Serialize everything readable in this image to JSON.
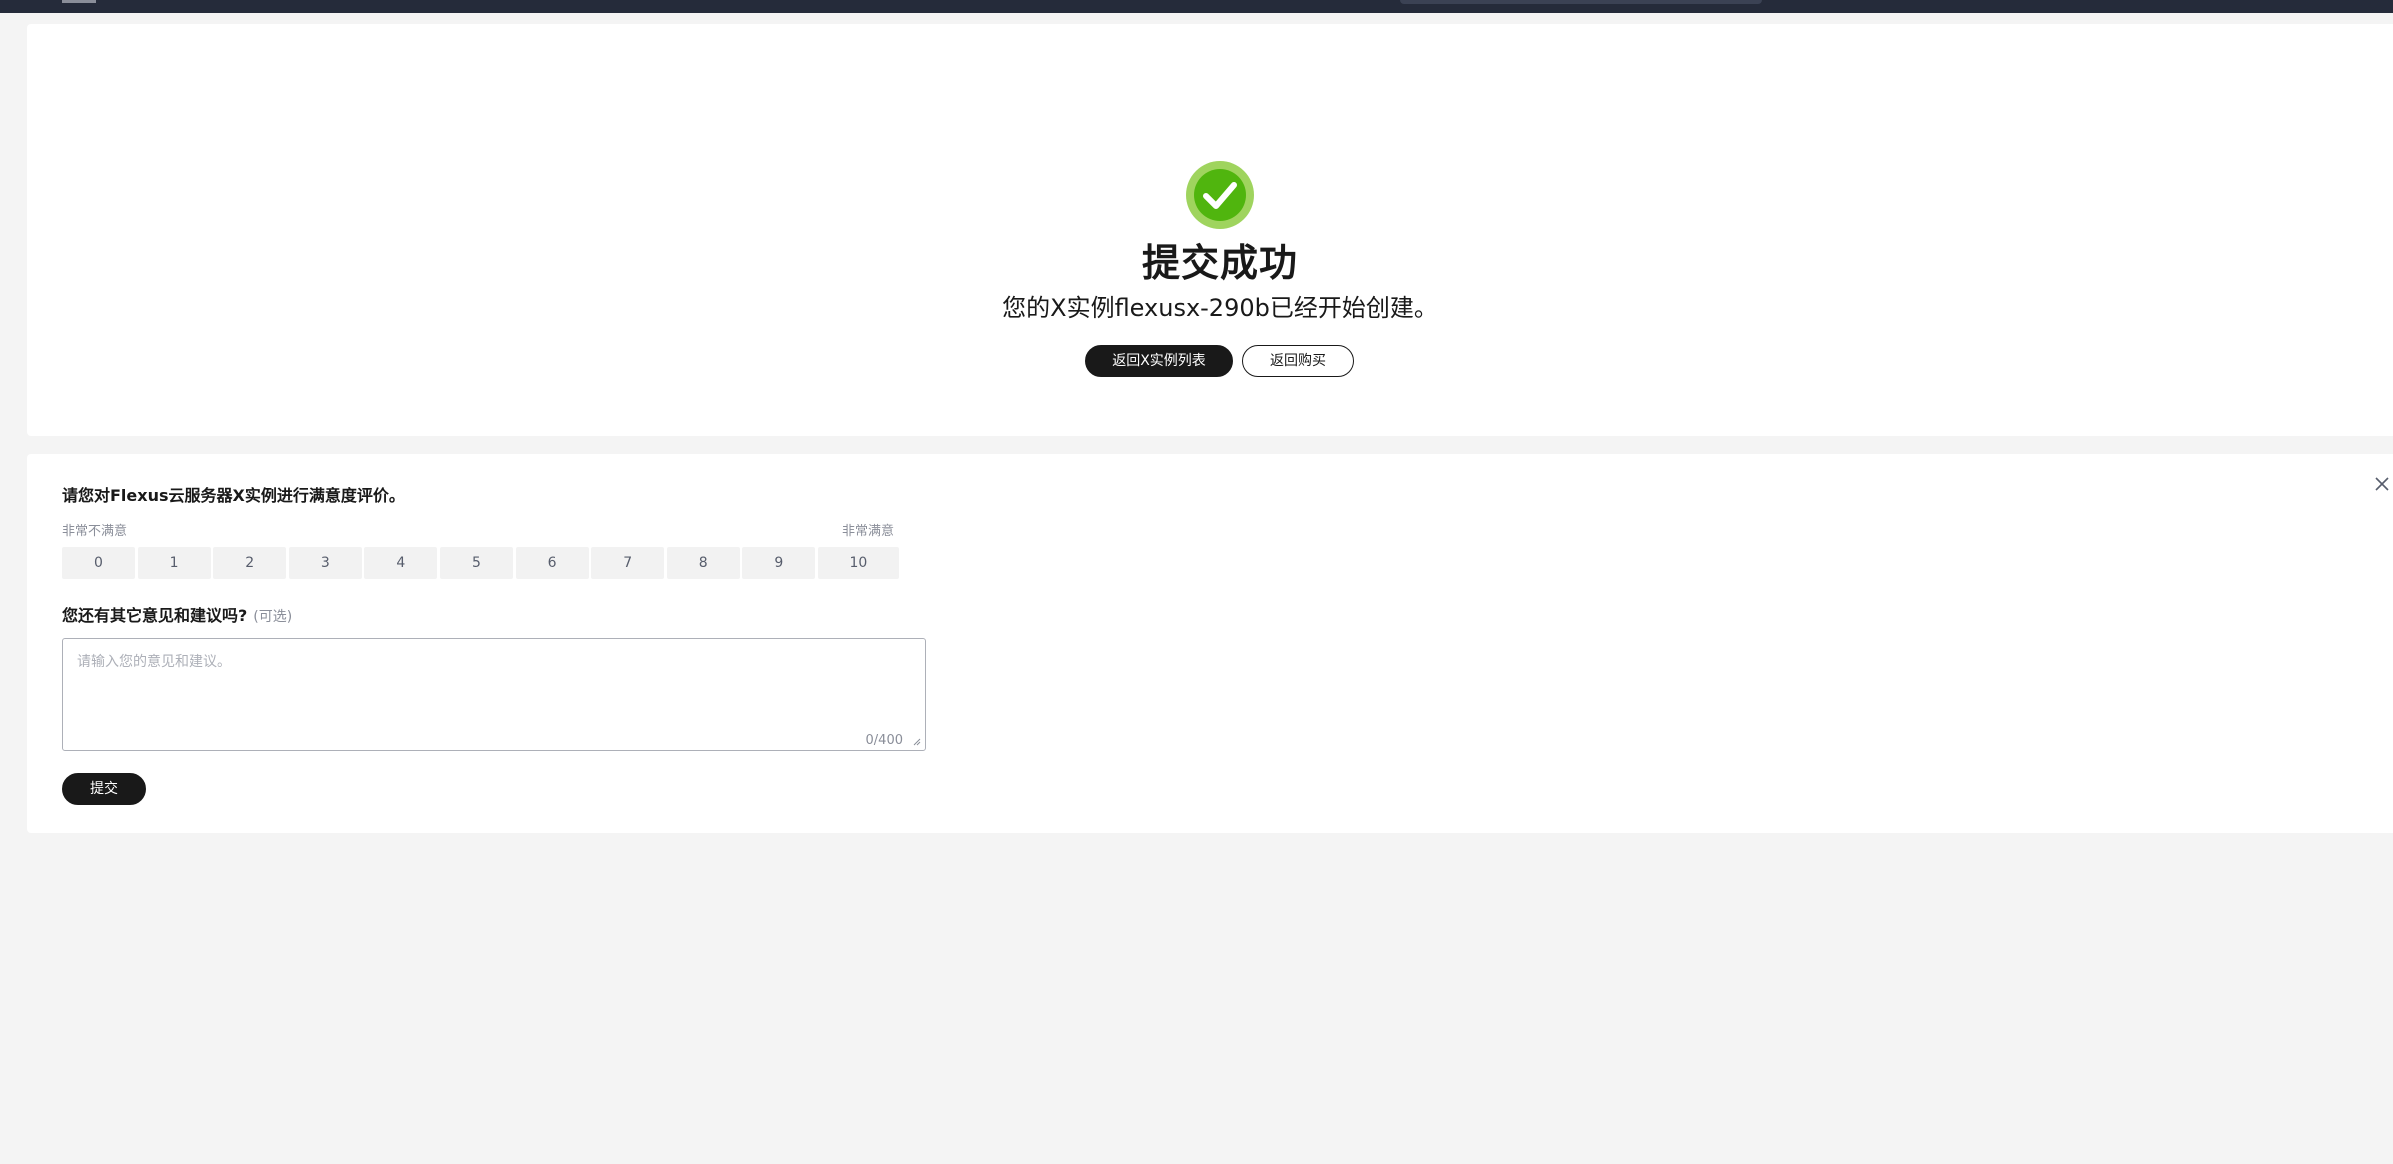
{
  "success": {
    "icon": "check-circle-icon",
    "title": "提交成功",
    "description": "您的X实例flexusx-290b已经开始创建。",
    "primary_button": "返回X实例列表",
    "secondary_button": "返回购买",
    "accent_color": "#50b50e"
  },
  "survey": {
    "title": "请您对Flexus云服务器X实例进行满意度评价。",
    "scale_low_label": "非常不满意",
    "scale_high_label": "非常满意",
    "ratings": [
      "0",
      "1",
      "2",
      "3",
      "4",
      "5",
      "6",
      "7",
      "8",
      "9",
      "10"
    ],
    "feedback_label": "您还有其它意见和建议吗?",
    "feedback_optional": "(可选)",
    "feedback_placeholder": "请输入您的意见和建议。",
    "feedback_counter": "0/400",
    "submit_button": "提交",
    "close_icon": "close-icon"
  }
}
